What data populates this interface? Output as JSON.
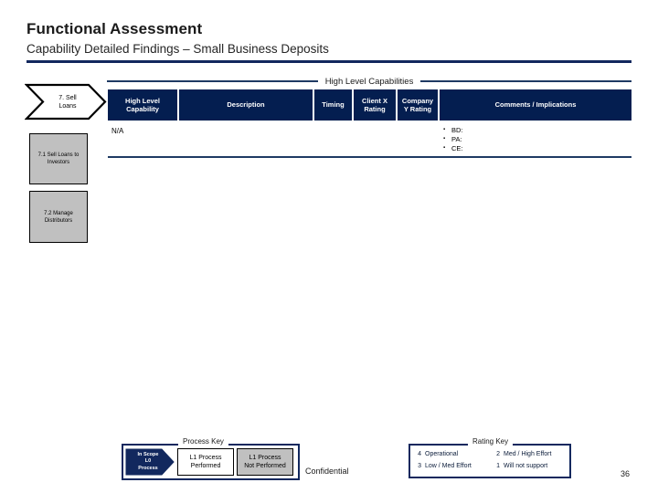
{
  "slide": {
    "title": "Functional Assessment",
    "subtitle": "Capability Detailed Findings – Small Business Deposits",
    "page_number": "36",
    "confidential_label": "Confidential",
    "accent_color": "#12285e",
    "header_fill_color": "#041e50",
    "subprocess_fill_color": "#c0c0c0"
  },
  "section_banner": {
    "label": "High Level Capabilities"
  },
  "stage": {
    "chevron_label_line1": "7. Sell",
    "chevron_label_line2": "Loans"
  },
  "subprocesses": [
    {
      "label": "7.1 Sell Loans to Investors"
    },
    {
      "label": "7.2 Manage Distributors"
    }
  ],
  "table": {
    "columns": [
      {
        "key": "high_level_capability",
        "label_line1": "High Level",
        "label_line2": "Capability"
      },
      {
        "key": "description",
        "label_line1": "Description",
        "label_line2": ""
      },
      {
        "key": "timing",
        "label_line1": "Timing",
        "label_line2": ""
      },
      {
        "key": "client_x_rating",
        "label_line1": "Client X",
        "label_line2": "Rating"
      },
      {
        "key": "company_y_rating",
        "label_line1": "Company",
        "label_line2": "Y Rating"
      },
      {
        "key": "comments_implications",
        "label_line1": "Comments / Implications",
        "label_line2": ""
      }
    ],
    "rows": [
      {
        "high_level_capability": "N/A",
        "description": "",
        "timing": "",
        "client_x_rating": "",
        "company_y_rating": "",
        "comments": [
          "BD:",
          "PA:",
          "CE:"
        ]
      }
    ]
  },
  "process_key": {
    "title": "Process Key",
    "in_scope_line1": "In Scope",
    "in_scope_line2": "L0",
    "in_scope_line3": "Process",
    "performed_line1": "L1 Process",
    "performed_line2": "Performed",
    "not_performed_line1": "L1 Process",
    "not_performed_line2": "Not Performed"
  },
  "rating_key": {
    "title": "Rating Key",
    "entries": [
      {
        "num": "4",
        "label": "Operational"
      },
      {
        "num": "2",
        "label": "Med / High Effort"
      },
      {
        "num": "3",
        "label": "Low / Med Effort"
      },
      {
        "num": "1",
        "label": "Will not support"
      }
    ]
  }
}
